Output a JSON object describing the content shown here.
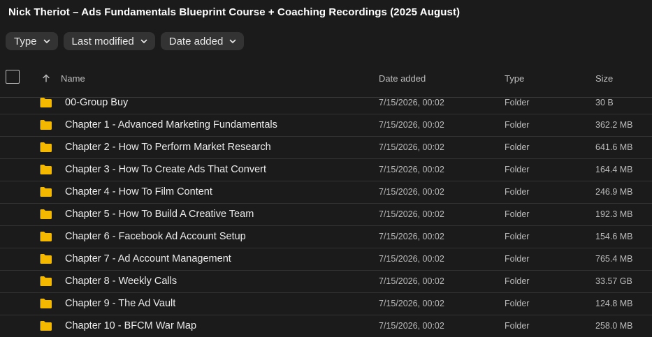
{
  "title": "Nick Theriot – Ads Fundamentals Blueprint Course + Coaching Recordings (2025 August)",
  "filters": [
    "Type",
    "Last modified",
    "Date added"
  ],
  "columns": {
    "name": "Name",
    "date_added": "Date added",
    "type": "Type",
    "size": "Size"
  },
  "rows": [
    {
      "name": "00-Group Buy",
      "date": "7/15/2026, 00:02",
      "type": "Folder",
      "size": "30 B"
    },
    {
      "name": "Chapter 1 - Advanced Marketing Fundamentals",
      "date": "7/15/2026, 00:02",
      "type": "Folder",
      "size": "362.2 MB"
    },
    {
      "name": "Chapter 2 - How To Perform Market Research",
      "date": "7/15/2026, 00:02",
      "type": "Folder",
      "size": "641.6 MB"
    },
    {
      "name": "Chapter 3 - How To Create Ads That Convert",
      "date": "7/15/2026, 00:02",
      "type": "Folder",
      "size": "164.4 MB"
    },
    {
      "name": "Chapter 4 - How To Film Content",
      "date": "7/15/2026, 00:02",
      "type": "Folder",
      "size": "246.9 MB"
    },
    {
      "name": "Chapter 5 - How To Build A Creative Team",
      "date": "7/15/2026, 00:02",
      "type": "Folder",
      "size": "192.3 MB"
    },
    {
      "name": "Chapter 6 - Facebook Ad Account Setup",
      "date": "7/15/2026, 00:02",
      "type": "Folder",
      "size": "154.6 MB"
    },
    {
      "name": "Chapter 7 - Ad Account Management",
      "date": "7/15/2026, 00:02",
      "type": "Folder",
      "size": "765.4 MB"
    },
    {
      "name": "Chapter 8 - Weekly Calls",
      "date": "7/15/2026, 00:02",
      "type": "Folder",
      "size": "33.57 GB"
    },
    {
      "name": "Chapter 9 - The Ad Vault",
      "date": "7/15/2026, 00:02",
      "type": "Folder",
      "size": "124.8 MB"
    },
    {
      "name": "Chapter 10 - BFCM War Map",
      "date": "7/15/2026, 00:02",
      "type": "Folder",
      "size": "258.0 MB"
    }
  ],
  "colors": {
    "background": "#1b1b1b",
    "chip": "#333333",
    "folder": "#f5b800"
  },
  "icons": {
    "sort": "arrow-up-icon",
    "folder": "folder-icon",
    "chip_dropdown": "chevron-down-icon"
  }
}
